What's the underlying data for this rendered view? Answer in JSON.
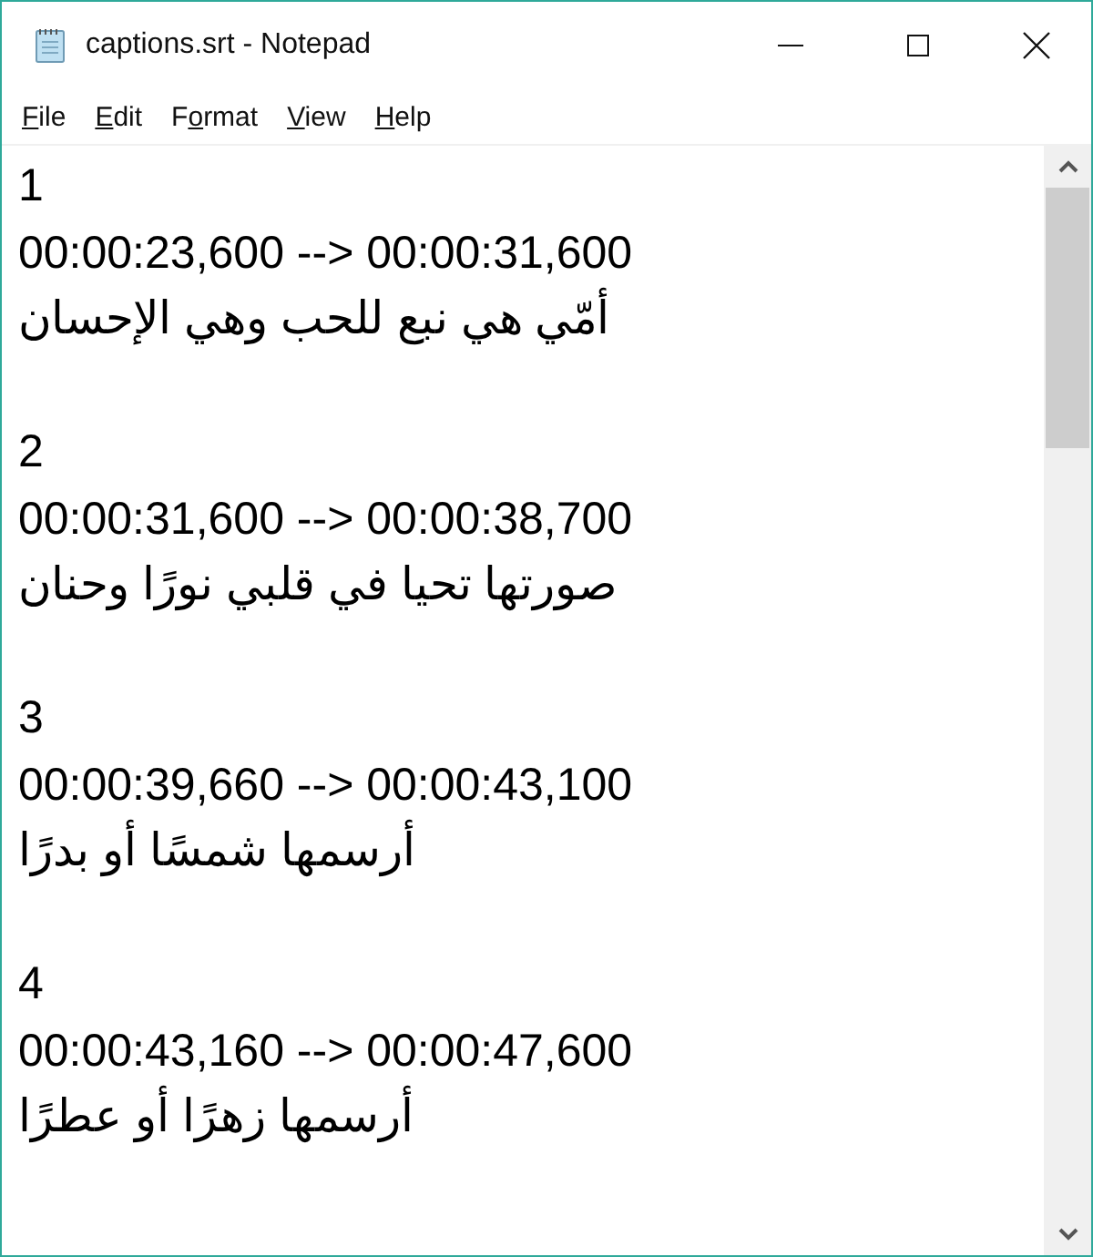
{
  "window": {
    "title": "captions.srt - Notepad"
  },
  "menu": [
    {
      "mnemonic": "F",
      "after": "ile"
    },
    {
      "mnemonic": "E",
      "after": "dit"
    },
    {
      "before": "F",
      "mnemonic": "o",
      "after": "rmat"
    },
    {
      "mnemonic": "V",
      "after": "iew"
    },
    {
      "mnemonic": "H",
      "after": "elp"
    }
  ],
  "captions": [
    {
      "number": "1",
      "timing": "00:00:23,600 --> 00:00:31,600",
      "text": "أمّي هي نبع للحب وهي الإحسان"
    },
    {
      "number": "2",
      "timing": "00:00:31,600 --> 00:00:38,700",
      "text": "صورتها تحيا في قلبي نورًا وحنان"
    },
    {
      "number": "3",
      "timing": "00:00:39,660 --> 00:00:43,100",
      "text": "أرسمها شمسًا أو بدرًا"
    },
    {
      "number": "4",
      "timing": "00:00:43,160 --> 00:00:47,600",
      "text": "أرسمها زهرًا أو عطرًا"
    }
  ]
}
